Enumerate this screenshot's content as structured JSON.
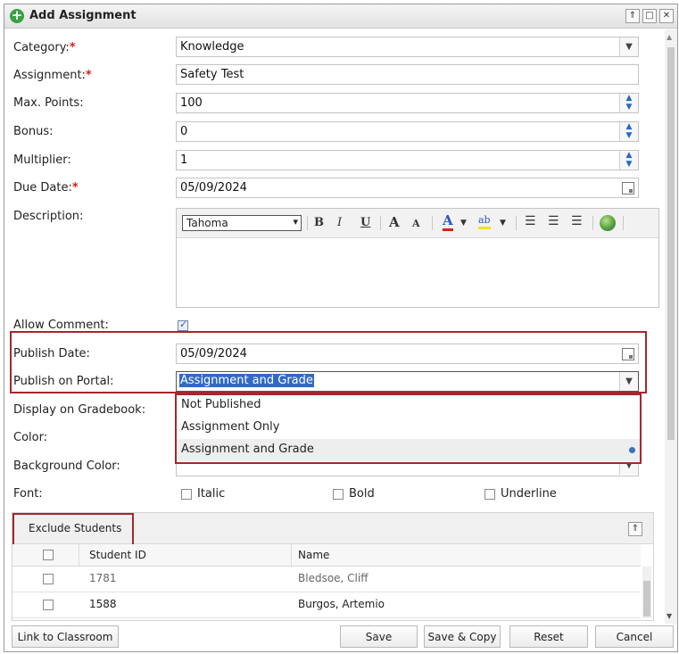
{
  "dialog": {
    "title": "Add Assignment",
    "controls": [
      "⇑",
      "□",
      "✕"
    ]
  },
  "form": {
    "required_mark": "*",
    "category": {
      "label": "Category:",
      "value": "Knowledge"
    },
    "assignment": {
      "label": "Assignment:",
      "value": "Safety Test"
    },
    "max_points": {
      "label": "Max. Points:",
      "value": "100"
    },
    "bonus": {
      "label": "Bonus:",
      "value": "0"
    },
    "multiplier": {
      "label": "Multiplier:",
      "value": "1"
    },
    "due_date": {
      "label": "Due Date:",
      "value": "05/09/2024"
    },
    "description": {
      "label": "Description:",
      "font": "Tahoma"
    },
    "allow_comment": {
      "label": "Allow Comment:",
      "checked": true
    },
    "publish_date": {
      "label": "Publish Date:",
      "value": "05/09/2024"
    },
    "publish_on_portal": {
      "label": "Publish on Portal:",
      "value": "Assignment and Grade",
      "options": [
        "Not Published",
        "Assignment Only",
        "Assignment and Grade"
      ]
    },
    "display_on_gradebook": {
      "label": "Display on Gradebook:"
    },
    "color": {
      "label": "Color:"
    },
    "background_color": {
      "label": "Background Color:"
    },
    "font": {
      "label": "Font:",
      "options": [
        "Italic",
        "Bold",
        "Underline"
      ]
    }
  },
  "editor_toolbar": {
    "bold": "B",
    "italic": "I",
    "underline": "U",
    "grow": "A",
    "shrink": "A",
    "font_color": "A",
    "highlight": "ab"
  },
  "exclude_students": {
    "title": "Exclude Students",
    "columns": [
      "Student ID",
      "Name"
    ],
    "rows": [
      {
        "id": "1781",
        "name": "Bledsoe, Cliff"
      },
      {
        "id": "1588",
        "name": "Burgos, Artemio"
      }
    ]
  },
  "footer": {
    "link_to_classroom": "Link to Classroom",
    "save": "Save",
    "save_copy": "Save & Copy",
    "reset": "Reset",
    "cancel": "Cancel"
  },
  "colors": {
    "accent_blue": "#2a67c4",
    "highlight_red": "#a3282f",
    "selection_bg": "#316ac5"
  }
}
